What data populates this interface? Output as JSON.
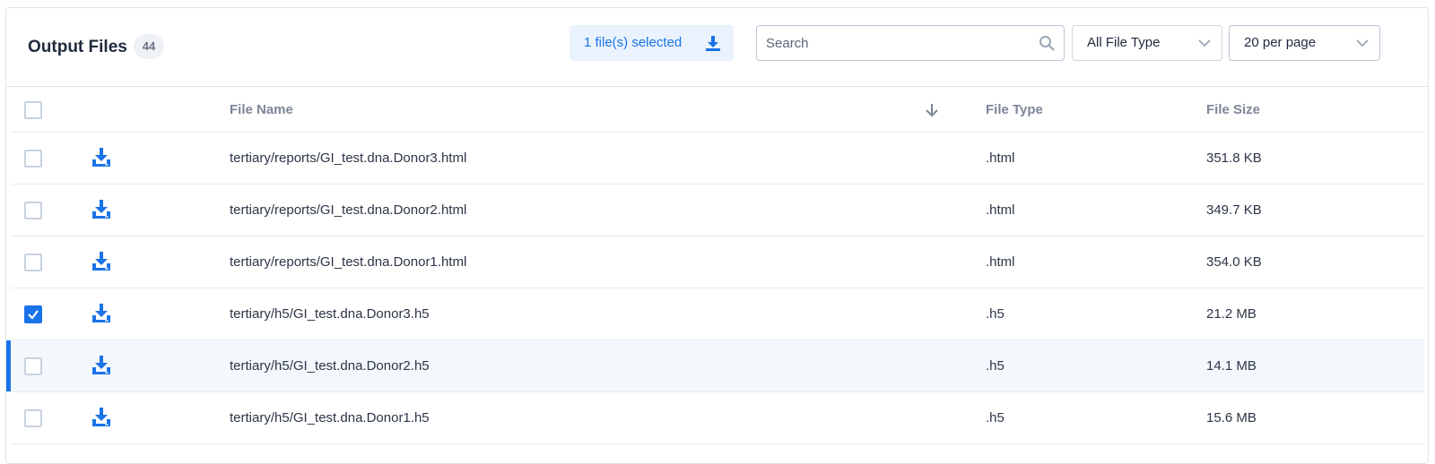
{
  "header": {
    "title": "Output Files",
    "count": "44",
    "selected_label": "1 file(s) selected",
    "search_placeholder": "Search",
    "file_type_filter": "All File Type",
    "page_size": "20 per page"
  },
  "table": {
    "columns": {
      "name": "File Name",
      "type": "File Type",
      "size": "File Size"
    },
    "rows": [
      {
        "name": "tertiary/reports/GI_test.dna.Donor3.html",
        "type": ".html",
        "size": "351.8 KB",
        "checked": false
      },
      {
        "name": "tertiary/reports/GI_test.dna.Donor2.html",
        "type": ".html",
        "size": "349.7 KB",
        "checked": false
      },
      {
        "name": "tertiary/reports/GI_test.dna.Donor1.html",
        "type": ".html",
        "size": "354.0 KB",
        "checked": false
      },
      {
        "name": "tertiary/h5/GI_test.dna.Donor3.h5",
        "type": ".h5",
        "size": "21.2 MB",
        "checked": true
      },
      {
        "name": "tertiary/h5/GI_test.dna.Donor2.h5",
        "type": ".h5",
        "size": "14.1 MB",
        "checked": false,
        "highlighted": true
      },
      {
        "name": "tertiary/h5/GI_test.dna.Donor1.h5",
        "type": ".h5",
        "size": "15.6 MB",
        "checked": false
      }
    ]
  },
  "colors": {
    "accent": "#1a73e8",
    "selected_bg": "#eaf3fd",
    "row_highlight": "#f3f8fd"
  },
  "icons": {
    "download": "download-icon",
    "search": "search-icon",
    "chevron": "chevron-down-icon",
    "sort": "sort-desc-icon",
    "check": "check-icon"
  }
}
